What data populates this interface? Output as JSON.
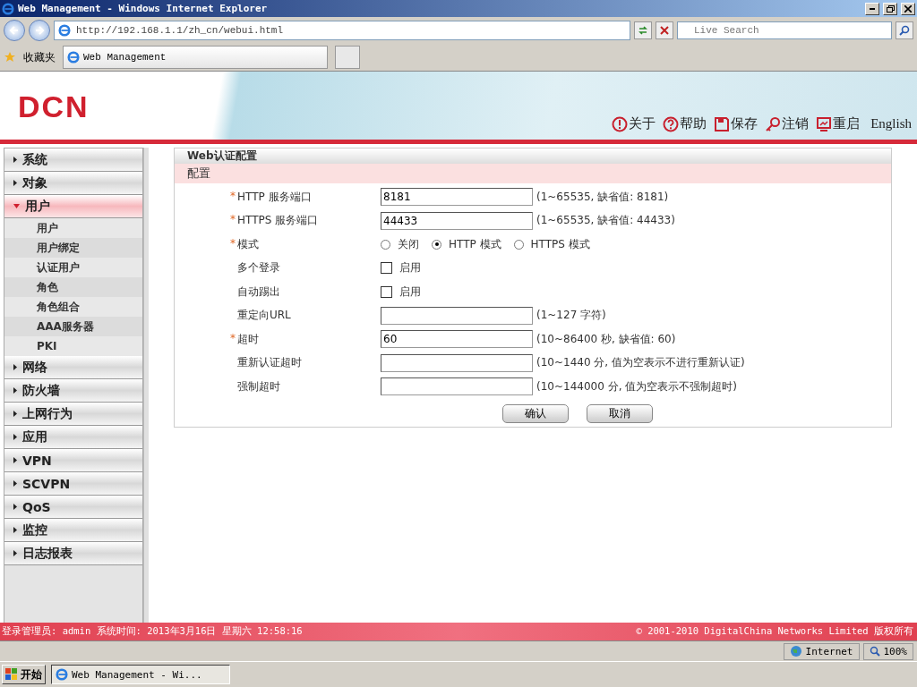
{
  "window": {
    "title": "Web Management - Windows Internet Explorer"
  },
  "browser": {
    "address": "http://192.168.1.1/zh_cn/webui.html",
    "search_placeholder": "Live Search",
    "favorites": "收藏夹",
    "tab": "Web Management"
  },
  "header": {
    "logo": "DCN",
    "actions": [
      {
        "kind": "about",
        "label": "关于"
      },
      {
        "kind": "help",
        "label": "帮助"
      },
      {
        "kind": "save",
        "label": "保存"
      },
      {
        "kind": "logout",
        "label": "注销"
      },
      {
        "kind": "restart",
        "label": "重启"
      }
    ],
    "language": "English"
  },
  "sidebar": {
    "items": [
      {
        "label": "系统",
        "expanded": false
      },
      {
        "label": "对象",
        "expanded": false
      },
      {
        "label": "用户",
        "expanded": true,
        "children": [
          {
            "label": "用户"
          },
          {
            "label": "用户绑定"
          },
          {
            "label": "认证用户"
          },
          {
            "label": "角色"
          },
          {
            "label": "角色组合"
          },
          {
            "label": "AAA服务器"
          },
          {
            "label": "PKI"
          }
        ]
      },
      {
        "label": "网络",
        "expanded": false
      },
      {
        "label": "防火墙",
        "expanded": false
      },
      {
        "label": "上网行为",
        "expanded": false
      },
      {
        "label": "应用",
        "expanded": false
      },
      {
        "label": "VPN",
        "expanded": false
      },
      {
        "label": "SCVPN",
        "expanded": false
      },
      {
        "label": "QoS",
        "expanded": false
      },
      {
        "label": "监控",
        "expanded": false
      },
      {
        "label": "日志报表",
        "expanded": false
      }
    ]
  },
  "panel": {
    "title": "Web认证配置",
    "section": "配置",
    "fields": [
      {
        "kind": "text",
        "mark": "*",
        "label": "HTTP 服务端口",
        "value": "8181",
        "hint": "(1~65535, 缺省值: 8181)"
      },
      {
        "kind": "text",
        "mark": "*",
        "label": "HTTPS 服务端口",
        "value": "44433",
        "hint": "(1~65535, 缺省值: 44433)"
      },
      {
        "kind": "radio",
        "mark": "*",
        "label": "模式",
        "options": [
          {
            "label": "关闭",
            "selected": false
          },
          {
            "label": "HTTP 模式",
            "selected": true
          },
          {
            "label": "HTTPS 模式",
            "selected": false
          }
        ]
      },
      {
        "kind": "checkbox",
        "label": "多个登录",
        "option": "启用",
        "checked": false
      },
      {
        "kind": "checkbox",
        "label": "自动踢出",
        "option": "启用",
        "checked": false
      },
      {
        "kind": "text",
        "label": "重定向URL",
        "hint": "(1~127 字符)"
      },
      {
        "kind": "text",
        "mark": "*",
        "label": "超时",
        "value": "60",
        "hint": "(10~86400 秒, 缺省值: 60)"
      },
      {
        "kind": "text",
        "label": "重新认证超时",
        "hint": "(10~1440 分, 值为空表示不进行重新认证)"
      },
      {
        "kind": "text",
        "label": "强制超时",
        "hint": "(10~144000 分, 值为空表示不强制超时)"
      }
    ],
    "buttons": [
      "确认",
      "取消"
    ]
  },
  "footer": {
    "left": "登录管理员: admin 系统时间: 2013年3月16日 星期六 12:58:16",
    "right": "© 2001-2010 DigitalChina Networks Limited 版权所有"
  },
  "status_bar": {
    "zone": "Internet",
    "zoom": "100%"
  },
  "taskbar": {
    "start": "开始",
    "task": "Web Management - Wi..."
  }
}
